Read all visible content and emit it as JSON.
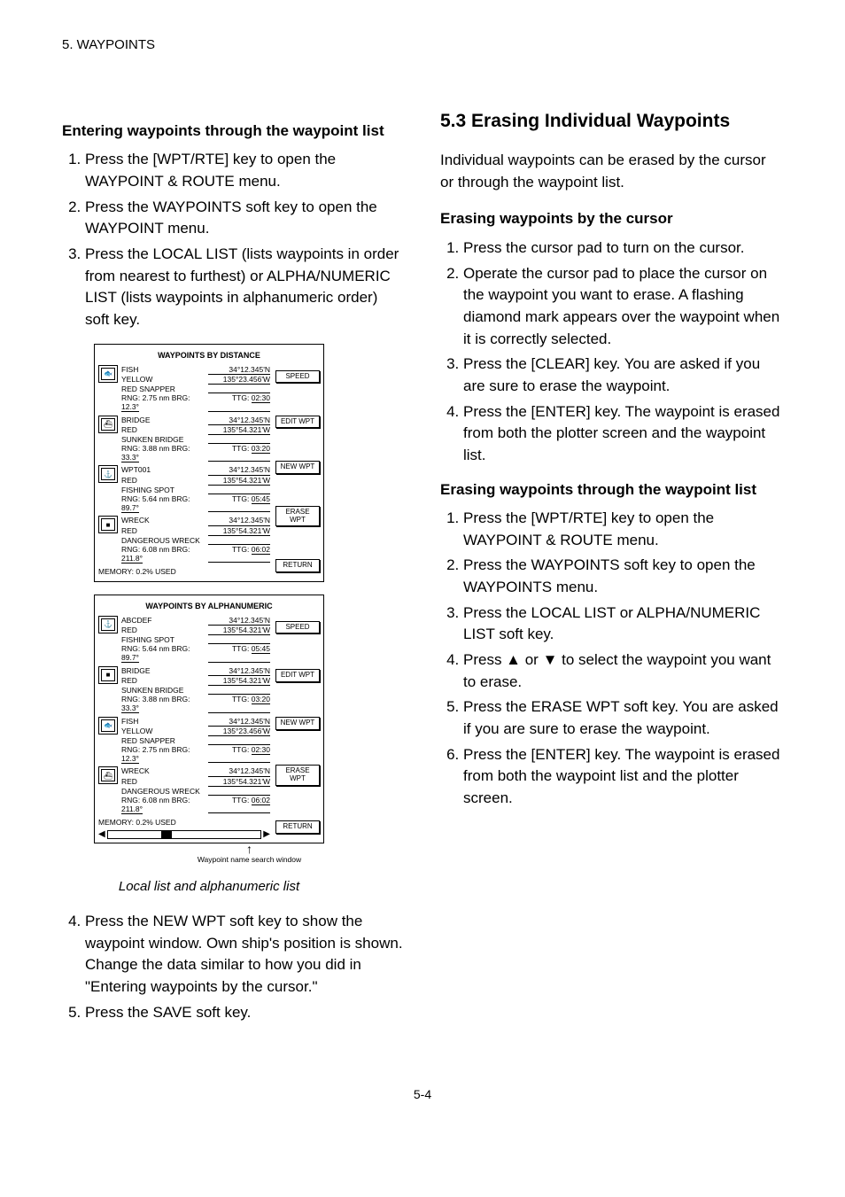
{
  "header": "5. WAYPOINTS",
  "left": {
    "sec_title": "Entering waypoints through the waypoint list",
    "steps": [
      "Press the [WPT/RTE] key to open the WAYPOINT & ROUTE menu.",
      "Press the WAYPOINTS soft key to open the WAYPOINT menu.",
      "Press the LOCAL LIST (lists waypoints in order from nearest to furthest) or ALPHA/NUMERIC LIST (lists waypoints in alphanumeric order) soft key."
    ],
    "steps2": [
      "Press the NEW WPT soft key to show the waypoint window. Own ship's position is shown. Change the data similar to how you did in \"Entering waypoints by the cursor.\"",
      "Press the SAVE soft key."
    ],
    "local_list": {
      "title": "WAYPOINTS BY DISTANCE",
      "softkeys": [
        "SPEED",
        "EDIT WPT",
        "NEW WPT",
        "ERASE WPT",
        "RETURN"
      ],
      "rows": [
        {
          "name": "FISH",
          "color": "YELLOW",
          "lat": "34°12.345'N",
          "lon": "135°23.456'W",
          "cmnt": "RED SNAPPER",
          "rng": "2.75 nm",
          "brg": "12.3°",
          "ttg": "02:30"
        },
        {
          "name": "BRIDGE",
          "color": "RED",
          "lat": "34°12.345'N",
          "lon": "135°54.321'W",
          "cmnt": "SUNKEN BRIDGE",
          "rng": "3.88 nm",
          "brg": "33.3°",
          "ttg": "03:20"
        },
        {
          "name": "WPT001",
          "color": "RED",
          "lat": "34°12.345'N",
          "lon": "135°54.321'W",
          "cmnt": "FISHING SPOT",
          "rng": "5.64 nm",
          "brg": "89.7°",
          "ttg": "05:45"
        },
        {
          "name": "WRECK",
          "color": "RED",
          "lat": "34°12.345'N",
          "lon": "135°54.321'W",
          "cmnt": "DANGEROUS WRECK",
          "rng": "6.08 nm",
          "brg": "211.8°",
          "ttg": "06:02"
        }
      ],
      "memory": "MEMORY:",
      "used": "0.2% USED"
    },
    "alpha_list": {
      "title": "WAYPOINTS BY ALPHANUMERIC",
      "softkeys": [
        "SPEED",
        "EDIT WPT",
        "NEW WPT",
        "ERASE WPT",
        "RETURN"
      ],
      "rows": [
        {
          "name": "ABCDEF",
          "color": "RED",
          "lat": "34°12.345'N",
          "lon": "135°54.321'W",
          "cmnt": "FISHING SPOT",
          "rng": "5.64 nm",
          "brg": "89.7°",
          "ttg": "05:45"
        },
        {
          "name": "BRIDGE",
          "color": "RED",
          "lat": "34°12.345'N",
          "lon": "135°54.321'W",
          "cmnt": "SUNKEN BRIDGE",
          "rng": "3.88 nm",
          "brg": "33.3°",
          "ttg": "03:20"
        },
        {
          "name": "FISH",
          "color": "YELLOW",
          "lat": "34°12.345'N",
          "lon": "135°23.456'W",
          "cmnt": "RED SNAPPER",
          "rng": "2.75 nm",
          "brg": "12.3°",
          "ttg": "02:30"
        },
        {
          "name": "WRECK",
          "color": "RED",
          "lat": "34°12.345'N",
          "lon": "135°54.321'W",
          "cmnt": "DANGEROUS WRECK",
          "rng": "6.08 nm",
          "brg": "211.8°",
          "ttg": "06:02"
        }
      ],
      "memory": "MEMORY:",
      "used": "0.2% USED",
      "scroll_label": "Waypoint name search window"
    },
    "caption": "Local list and alphanumeric list"
  },
  "right": {
    "sec_title": "5.3 Erasing Individual Waypoints",
    "intro": "Individual waypoints can be erased by the cursor or through the waypoint list.",
    "sub1_title": "Erasing waypoints by the cursor",
    "sub1_steps": [
      "Press the cursor pad to turn on the cursor.",
      "Operate the cursor pad to place the cursor on the waypoint you want to erase. A flashing diamond mark appears over the waypoint when it is correctly selected.",
      "Press the [CLEAR] key. You are asked if you are sure to erase the waypoint.",
      "Press the [ENTER] key. The waypoint is erased from both the plotter screen and the waypoint list."
    ],
    "sub2_title": "Erasing waypoints through the waypoint list",
    "sub2_steps": [
      "Press the [WPT/RTE] key to open the WAYPOINT & ROUTE menu.",
      "Press the WAYPOINTS soft key to open the WAYPOINTS menu.",
      "Press the LOCAL LIST or ALPHA/NUMERIC LIST soft key.",
      "Press ▲ or ▼ to select the waypoint you want to erase.",
      "Press the ERASE WPT soft key. You are asked if you are sure to erase the waypoint.",
      "Press the [ENTER] key. The waypoint is erased from both the waypoint list and the plotter screen."
    ]
  },
  "page_number": "5-4"
}
